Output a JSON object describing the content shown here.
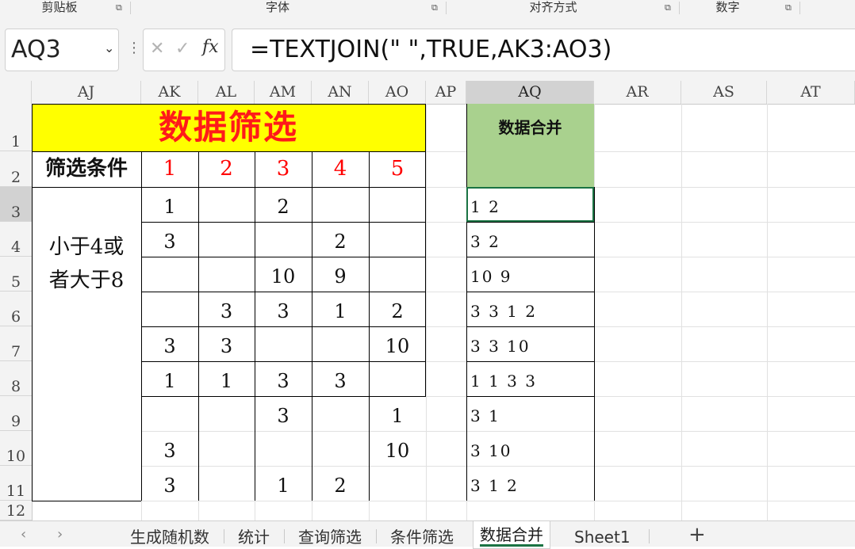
{
  "ribbon": {
    "groups": [
      {
        "label": "剪贴板"
      },
      {
        "label": "字体"
      },
      {
        "label": "对齐方式"
      },
      {
        "label": "数字"
      }
    ],
    "launcher_glyph": "⧉"
  },
  "formula_bar": {
    "name_box": "AQ3",
    "cancel_glyph": "✕",
    "enter_glyph": "✓",
    "insert_function": "fx",
    "formula": "=TEXTJOIN(\" \",TRUE,AK3:AO3)"
  },
  "columns": [
    "AJ",
    "AK",
    "AL",
    "AM",
    "AN",
    "AO",
    "AP",
    "AQ",
    "AR",
    "AS",
    "AT"
  ],
  "rows": [
    "1",
    "2",
    "3",
    "4",
    "5",
    "6",
    "7",
    "8",
    "9",
    "10",
    "11",
    "12"
  ],
  "sheet": {
    "title": "数据筛选",
    "merge_header": "数据合并",
    "condition_label": "筛选条件",
    "condition_numbers": [
      "1",
      "2",
      "3",
      "4",
      "5"
    ],
    "condition_text_line1": "小于4或",
    "condition_text_line2": "者大于8",
    "data": [
      [
        "1",
        "",
        "2",
        "",
        ""
      ],
      [
        "3",
        "",
        "",
        "2",
        ""
      ],
      [
        "",
        "",
        "10",
        "9",
        ""
      ],
      [
        "",
        "3",
        "3",
        "1",
        "2"
      ],
      [
        "3",
        "3",
        "",
        "",
        "10"
      ],
      [
        "1",
        "1",
        "3",
        "3",
        ""
      ],
      [
        "",
        "",
        "3",
        "",
        "1"
      ],
      [
        "3",
        "",
        "",
        "",
        "10"
      ],
      [
        "3",
        "",
        "1",
        "2",
        ""
      ]
    ],
    "merged": [
      "1 2",
      "3 2",
      "10 9",
      "3 3 1 2",
      "3 3 10",
      "1 1 3 3",
      "3 1",
      "3 10",
      "3 1 2"
    ]
  },
  "sheet_tabs": {
    "prev": "‹",
    "next": "›",
    "tabs": [
      "生成随机数",
      "统计",
      "查询筛选",
      "条件筛选",
      "数据合并",
      "Sheet1"
    ],
    "active": "数据合并",
    "add": "+"
  },
  "colors": {
    "title_bg": "#ffff00",
    "title_text": "#ff1a1a",
    "merge_header_bg": "#a9d18e",
    "condition_number": "#ff0000",
    "selection": "#1a7343"
  }
}
